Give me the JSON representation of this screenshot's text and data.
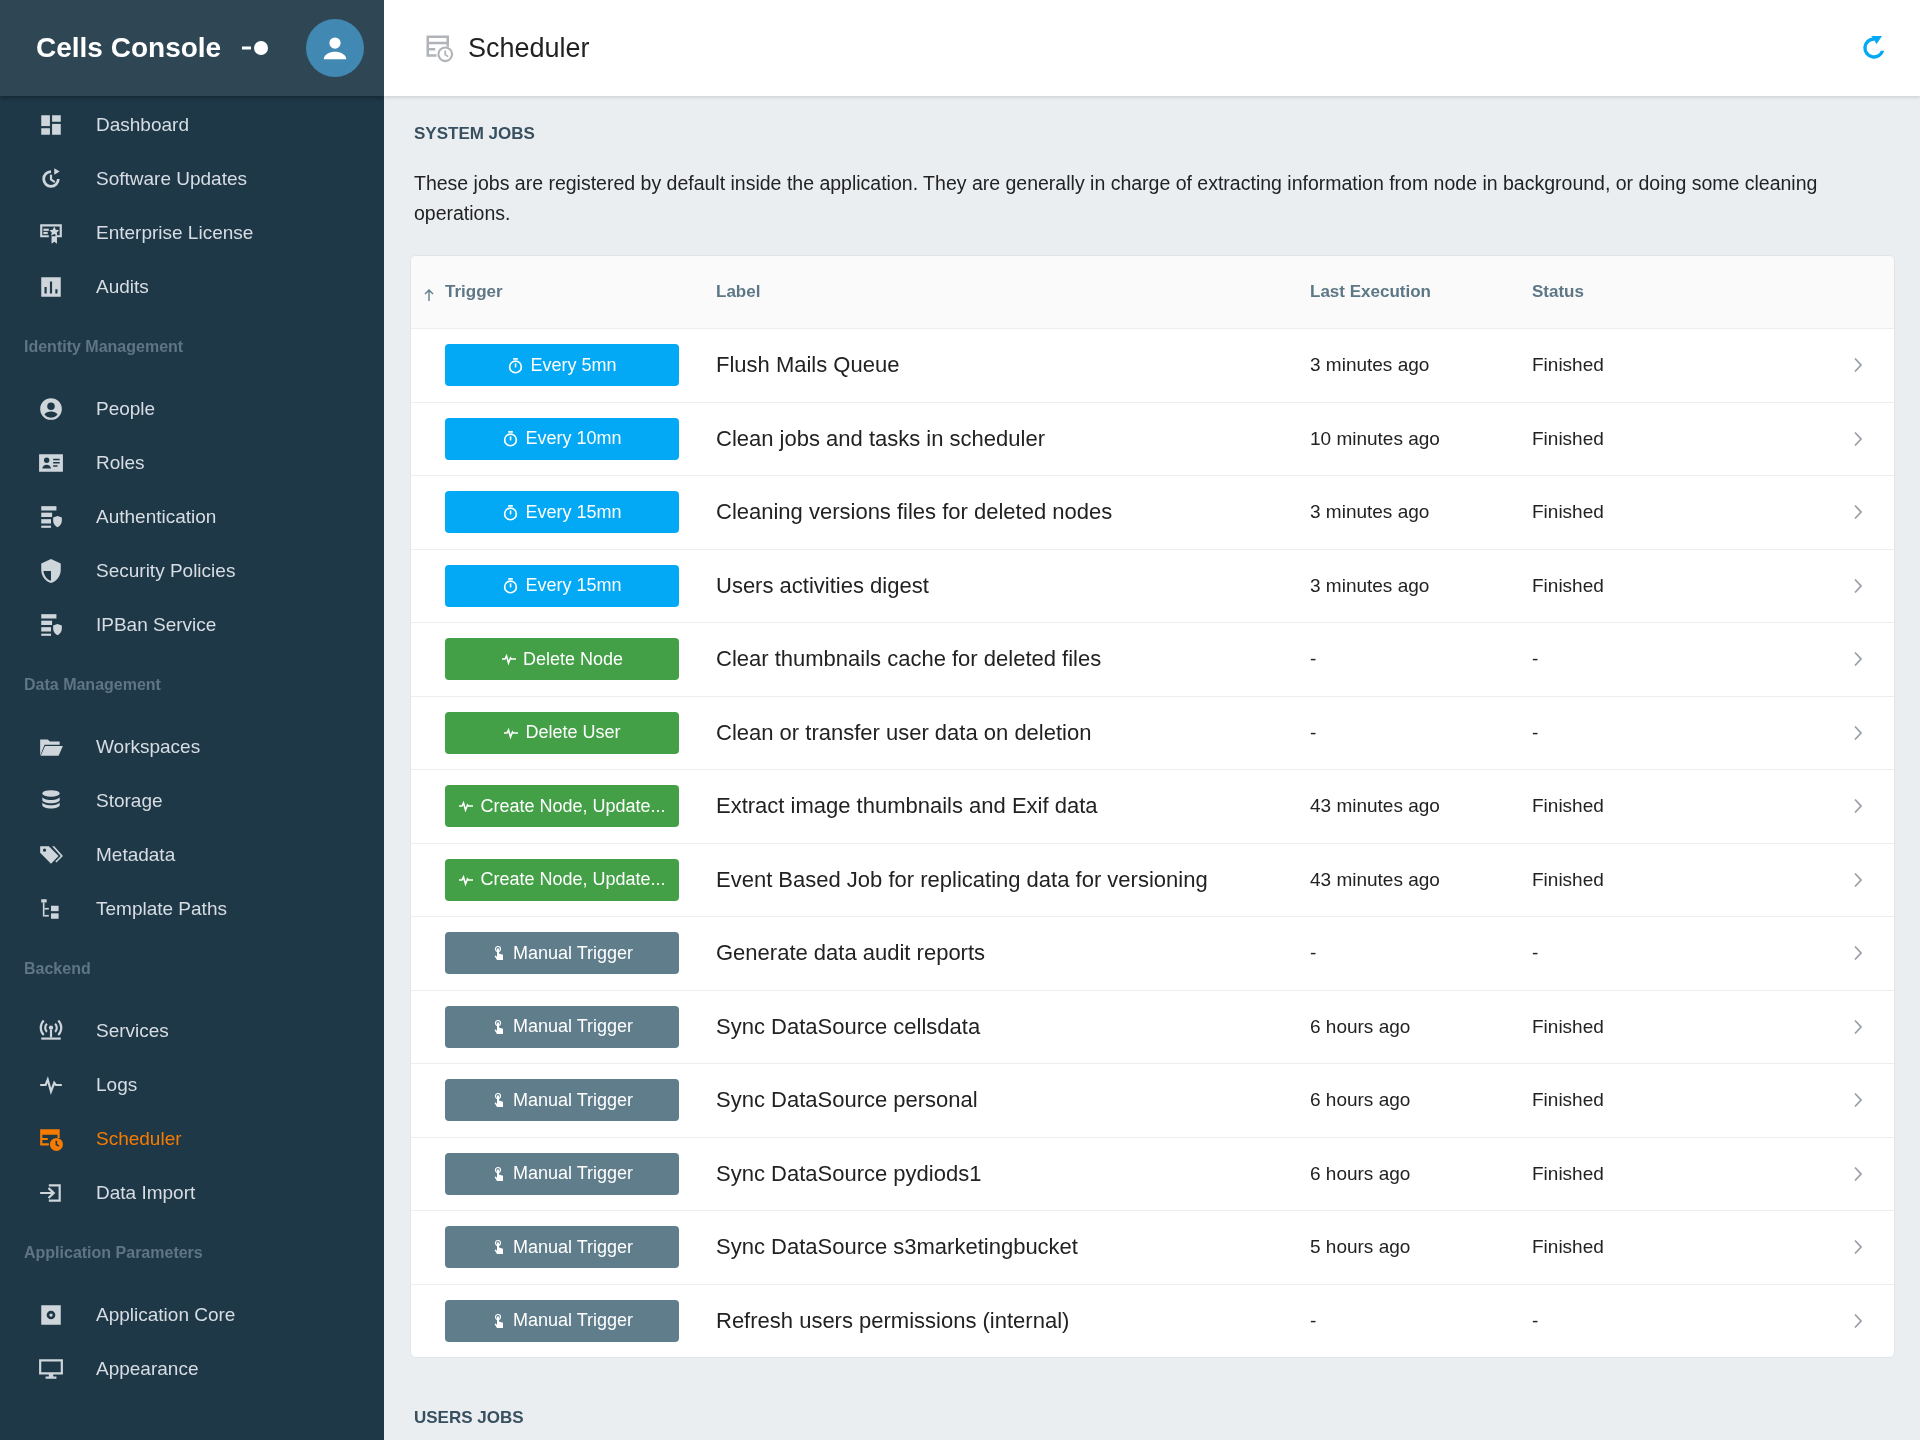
{
  "sidebar": {
    "title": "Cells Console",
    "sections": [
      {
        "items": [
          {
            "label": "Dashboard",
            "selected": false
          },
          {
            "label": "Software Updates",
            "selected": false
          },
          {
            "label": "Enterprise License",
            "selected": false
          },
          {
            "label": "Audits",
            "selected": false
          }
        ]
      },
      {
        "heading": "Identity Management",
        "items": [
          {
            "label": "People",
            "selected": false
          },
          {
            "label": "Roles",
            "selected": false
          },
          {
            "label": "Authentication",
            "selected": false
          },
          {
            "label": "Security Policies",
            "selected": false
          },
          {
            "label": "IPBan Service",
            "selected": false
          }
        ]
      },
      {
        "heading": "Data Management",
        "items": [
          {
            "label": "Workspaces",
            "selected": false
          },
          {
            "label": "Storage",
            "selected": false
          },
          {
            "label": "Metadata",
            "selected": false
          },
          {
            "label": "Template Paths",
            "selected": false
          }
        ]
      },
      {
        "heading": "Backend",
        "items": [
          {
            "label": "Services",
            "selected": false
          },
          {
            "label": "Logs",
            "selected": false
          },
          {
            "label": "Scheduler",
            "selected": true
          },
          {
            "label": "Data Import",
            "selected": false
          }
        ]
      },
      {
        "heading": "Application Parameters",
        "items": [
          {
            "label": "Application Core",
            "selected": false
          },
          {
            "label": "Appearance",
            "selected": false
          }
        ]
      }
    ]
  },
  "page": {
    "title": "Scheduler"
  },
  "system_jobs": {
    "heading": "SYSTEM JOBS",
    "description": "These jobs are registered by default inside the application. They are generally in charge of extracting information from node in background, or doing some cleaning operations.",
    "table": {
      "columns": [
        "Trigger",
        "Label",
        "Last Execution",
        "Status"
      ],
      "rows": [
        {
          "trigger": {
            "kind": "schedule",
            "label": "Every 5mn"
          },
          "label": "Flush Mails Queue",
          "last_execution": "3 minutes ago",
          "status": "Finished"
        },
        {
          "trigger": {
            "kind": "schedule",
            "label": "Every 10mn"
          },
          "label": "Clean jobs and tasks in scheduler",
          "last_execution": "10 minutes ago",
          "status": "Finished"
        },
        {
          "trigger": {
            "kind": "schedule",
            "label": "Every 15mn"
          },
          "label": "Cleaning versions files for deleted nodes",
          "last_execution": "3 minutes ago",
          "status": "Finished"
        },
        {
          "trigger": {
            "kind": "schedule",
            "label": "Every 15mn"
          },
          "label": "Users activities digest",
          "last_execution": "3 minutes ago",
          "status": "Finished"
        },
        {
          "trigger": {
            "kind": "event",
            "label": "Delete Node"
          },
          "label": "Clear thumbnails cache for deleted files",
          "last_execution": "-",
          "status": "-"
        },
        {
          "trigger": {
            "kind": "event",
            "label": "Delete User"
          },
          "label": "Clean or transfer user data on deletion",
          "last_execution": "-",
          "status": "-"
        },
        {
          "trigger": {
            "kind": "event",
            "label": "Create Node, Update..."
          },
          "label": "Extract image thumbnails and Exif data",
          "last_execution": "43 minutes ago",
          "status": "Finished"
        },
        {
          "trigger": {
            "kind": "event",
            "label": "Create Node, Update..."
          },
          "label": "Event Based Job for replicating data for versioning",
          "last_execution": "43 minutes ago",
          "status": "Finished"
        },
        {
          "trigger": {
            "kind": "manual",
            "label": "Manual Trigger"
          },
          "label": "Generate data audit reports",
          "last_execution": "-",
          "status": "-"
        },
        {
          "trigger": {
            "kind": "manual",
            "label": "Manual Trigger"
          },
          "label": "Sync DataSource cellsdata",
          "last_execution": "6 hours ago",
          "status": "Finished"
        },
        {
          "trigger": {
            "kind": "manual",
            "label": "Manual Trigger"
          },
          "label": "Sync DataSource personal",
          "last_execution": "6 hours ago",
          "status": "Finished"
        },
        {
          "trigger": {
            "kind": "manual",
            "label": "Manual Trigger"
          },
          "label": "Sync DataSource pydiods1",
          "last_execution": "6 hours ago",
          "status": "Finished"
        },
        {
          "trigger": {
            "kind": "manual",
            "label": "Manual Trigger"
          },
          "label": "Sync DataSource s3marketingbucket",
          "last_execution": "5 hours ago",
          "status": "Finished"
        },
        {
          "trigger": {
            "kind": "manual",
            "label": "Manual Trigger"
          },
          "label": "Refresh users permissions (internal)",
          "last_execution": "-",
          "status": "-"
        }
      ]
    }
  },
  "users_jobs": {
    "heading": "USERS JOBS"
  }
}
